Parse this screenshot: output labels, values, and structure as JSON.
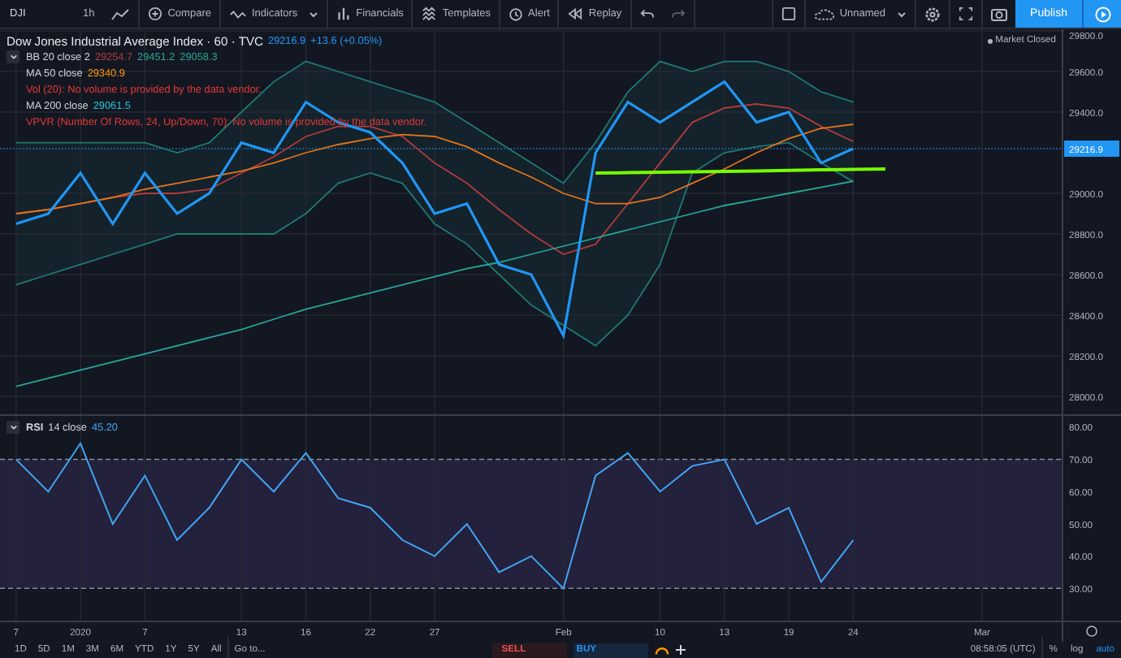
{
  "toolbar": {
    "symbol": "DJI",
    "interval": "1h",
    "buttons": [
      {
        "label": "Compare"
      },
      {
        "label": "Indicators"
      },
      {
        "label": "Financials"
      },
      {
        "label": "Templates"
      },
      {
        "label": "Alert"
      },
      {
        "label": "Replay"
      }
    ],
    "layout_name": "Unnamed",
    "publish": "Publish"
  },
  "legend": {
    "title": "Dow Jones Industrial Average Index · 60 · TVC",
    "last": "29216.9",
    "change": "+13.6 (+0.05%)",
    "studies": [
      {
        "kind": "study",
        "name": "BB 20 close 2",
        "values": [
          {
            "text": "29254.7",
            "color": "#b23b3b"
          },
          {
            "text": "29451.2",
            "color": "#26a69a"
          },
          {
            "text": "29058.3",
            "color": "#26a69a"
          }
        ]
      },
      {
        "kind": "study",
        "name": "MA 50 close",
        "values": [
          {
            "text": "29340.9",
            "color": "#ff9800"
          }
        ]
      },
      {
        "kind": "error",
        "text": "Vol (20): No volume is provided by the data vendor."
      },
      {
        "kind": "study",
        "name": "MA 200 close",
        "values": [
          {
            "text": "29061.5",
            "color": "#26c6da"
          }
        ]
      },
      {
        "kind": "error",
        "text": "VPVR (Number Of Rows, 24, Up/Down, 70): No volume is provided by the data vendor."
      }
    ]
  },
  "market_status": "Market Closed",
  "price_chart": {
    "last_price_label": "29216.9",
    "chart_data": {
      "type": "line",
      "grid": true,
      "ylim": [
        28000,
        29800
      ],
      "categories": [
        null,
        null,
        null,
        null,
        null,
        null,
        null,
        null,
        null,
        null,
        null,
        null,
        null,
        null,
        null,
        null,
        null,
        null,
        null,
        null,
        null,
        null,
        null,
        null,
        null,
        null,
        null,
        null,
        null,
        null,
        null,
        null,
        null
      ],
      "yticks": [
        {
          "value": 28000,
          "label": "28000.0"
        },
        {
          "value": 28200,
          "label": "28200.0"
        },
        {
          "value": 28400,
          "label": "28400.0"
        },
        {
          "value": 28600,
          "label": "28600.0"
        },
        {
          "value": 28800,
          "label": "28800.0"
        },
        {
          "value": 29000,
          "label": "29000.0"
        },
        {
          "value": 29400,
          "label": "29400.0"
        },
        {
          "value": 29600,
          "label": "29600.0"
        },
        {
          "value": 29800,
          "label": "29800.0"
        }
      ],
      "series": [
        {
          "color": "#2196f3",
          "values": [
            28850,
            28900,
            29100,
            28850,
            29100,
            28900,
            29000,
            29250,
            29200,
            29450,
            29350,
            29300,
            29150,
            28900,
            28950,
            28650,
            28600,
            28300,
            29200,
            29450,
            29350,
            29450,
            29550,
            29350,
            29400,
            29150,
            29220,
            null,
            null,
            null,
            null,
            null,
            null
          ]
        },
        {
          "color": "#b23b3b",
          "values": [
            28900,
            28920,
            28950,
            28980,
            29000,
            29000,
            29020,
            29100,
            29180,
            29280,
            29330,
            29330,
            29280,
            29150,
            29050,
            28920,
            28800,
            28700,
            28750,
            28950,
            29150,
            29350,
            29420,
            29440,
            29420,
            29330,
            29255,
            null,
            null,
            null,
            null,
            null,
            null
          ]
        },
        {
          "color": "#1f7a72",
          "values": [
            29250,
            29250,
            29250,
            29250,
            29250,
            29200,
            29250,
            29400,
            29550,
            29650,
            29600,
            29550,
            29500,
            29450,
            29350,
            29250,
            29150,
            29050,
            29250,
            29500,
            29650,
            29600,
            29650,
            29650,
            29600,
            29500,
            29450,
            null,
            null,
            null,
            null,
            null,
            null
          ]
        },
        {
          "color": "#1f7a72",
          "values": [
            28550,
            28600,
            28650,
            28700,
            28750,
            28800,
            28800,
            28800,
            28800,
            28900,
            29050,
            29100,
            29050,
            28850,
            28750,
            28600,
            28450,
            28350,
            28250,
            28400,
            28650,
            29100,
            29200,
            29230,
            29250,
            29150,
            29058,
            null,
            null,
            null,
            null,
            null,
            null
          ]
        },
        {
          "color": "#e0741c",
          "values": [
            28900,
            28920,
            28950,
            28980,
            29020,
            29050,
            29080,
            29110,
            29150,
            29200,
            29240,
            29270,
            29290,
            29280,
            29230,
            29150,
            29080,
            29000,
            28950,
            28950,
            28980,
            29050,
            29120,
            29200,
            29270,
            29320,
            29340,
            null,
            null,
            null,
            null,
            null,
            null
          ]
        },
        {
          "color": "#26a69a",
          "values": [
            28050,
            28090,
            28130,
            28170,
            28210,
            28250,
            28290,
            28330,
            28380,
            28430,
            28470,
            28510,
            28550,
            28590,
            28630,
            28660,
            28700,
            28740,
            28780,
            28820,
            28860,
            28900,
            28940,
            28970,
            29000,
            29030,
            29060,
            null,
            null,
            null,
            null,
            null,
            null
          ]
        },
        {
          "color": "#76ff03",
          "values": [
            null,
            null,
            null,
            null,
            null,
            null,
            null,
            null,
            null,
            null,
            null,
            null,
            null,
            null,
            null,
            null,
            null,
            null,
            29100,
            29102,
            29104,
            29106,
            29108,
            29110,
            29113,
            29116,
            29118,
            29120,
            null,
            null,
            null,
            null,
            null
          ]
        }
      ]
    }
  },
  "rsi_pane": {
    "name": "RSI",
    "params": "14 close",
    "value": "45.20",
    "chart_data": {
      "type": "line",
      "grid": true,
      "ylim": [
        20,
        84
      ],
      "categories": [
        "7",
        null,
        "2020",
        null,
        "7",
        null,
        null,
        "13",
        null,
        "16",
        null,
        "22",
        null,
        "27",
        null,
        null,
        null,
        "Feb",
        null,
        null,
        "10",
        null,
        "13",
        null,
        "19",
        null,
        "24",
        null,
        null,
        null,
        "Mar",
        null,
        null
      ],
      "yticks": [
        {
          "value": 80,
          "label": "80.00"
        },
        {
          "value": 70,
          "label": "70.00"
        },
        {
          "value": 60,
          "label": "60.00"
        },
        {
          "value": 50,
          "label": "50.00"
        },
        {
          "value": 40,
          "label": "40.00"
        },
        {
          "value": 30,
          "label": "30.00"
        }
      ],
      "series": [
        {
          "color": "#42a5f5",
          "values": [
            70,
            60,
            75,
            50,
            65,
            45,
            55,
            70,
            60,
            72,
            58,
            55,
            45,
            40,
            50,
            35,
            40,
            30,
            65,
            72,
            60,
            68,
            70,
            50,
            55,
            32,
            45,
            null,
            null,
            null,
            null,
            null,
            null
          ]
        }
      ]
    }
  },
  "bottom_bar": {
    "ranges": [
      "1D",
      "5D",
      "1M",
      "3M",
      "6M",
      "YTD",
      "1Y",
      "5Y",
      "All"
    ],
    "goto": "Go to...",
    "sell": "SELL",
    "buy": "BUY",
    "time": "08:58:05 (UTC)",
    "scale_options": [
      {
        "label": "%",
        "selected": false
      },
      {
        "label": "log",
        "selected": false
      },
      {
        "label": "auto",
        "selected": true
      }
    ]
  }
}
